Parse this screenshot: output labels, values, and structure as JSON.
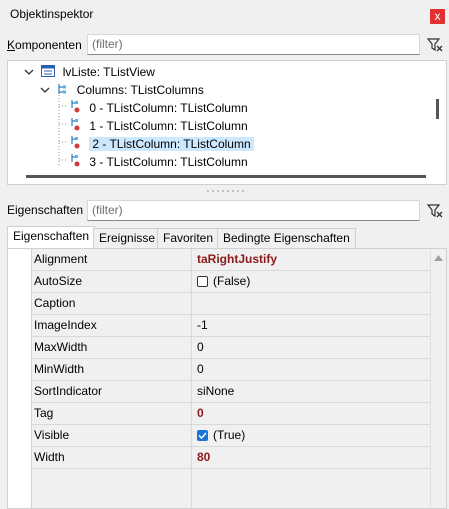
{
  "window": {
    "title": "Objektinspektor",
    "close_glyph": "x"
  },
  "components": {
    "label": "Komponenten",
    "filter_placeholder": "(filter)"
  },
  "tree": {
    "items": [
      {
        "label": "lvListe: TListView"
      },
      {
        "label": "Columns: TListColumns"
      },
      {
        "label": "0 - TListColumn: TListColumn"
      },
      {
        "label": "1 - TListColumn: TListColumn"
      },
      {
        "label": "2 - TListColumn: TListColumn",
        "selected": true
      },
      {
        "label": "3 - TListColumn: TListColumn"
      }
    ]
  },
  "properties": {
    "label": "Eigenschaften",
    "filter_placeholder": "(filter)"
  },
  "tabs": [
    {
      "label": "Eigenschaften",
      "active": true
    },
    {
      "label": "Ereignisse"
    },
    {
      "label": "Favoriten"
    },
    {
      "label": "Bedingte Eigenschaften"
    }
  ],
  "grid": {
    "rows": [
      {
        "name": "Alignment",
        "value": "taRightJustify",
        "modified": true
      },
      {
        "name": "AutoSize",
        "value": "(False)",
        "checkbox": false
      },
      {
        "name": "Caption",
        "value": ""
      },
      {
        "name": "ImageIndex",
        "value": "-1"
      },
      {
        "name": "MaxWidth",
        "value": "0"
      },
      {
        "name": "MinWidth",
        "value": "0"
      },
      {
        "name": "SortIndicator",
        "value": "siNone"
      },
      {
        "name": "Tag",
        "value": "0",
        "modified": true
      },
      {
        "name": "Visible",
        "value": "(True)",
        "checkbox": true
      },
      {
        "name": "Width",
        "value": "80",
        "modified": true
      }
    ]
  },
  "colors": {
    "accent": "#1a73d9",
    "modified": "#8b1a1a",
    "selection": "#cce8ff"
  }
}
